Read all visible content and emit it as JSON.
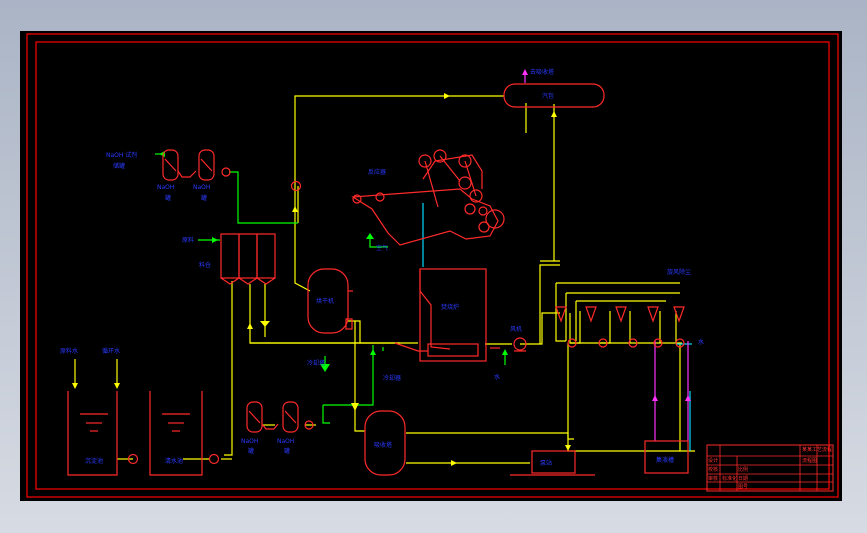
{
  "colors": {
    "background": "#000000",
    "frame": "#ff0000",
    "equipment": "#ff2a2a",
    "pipe_main": "#ffff00",
    "pipe_green": "#00ff00",
    "pipe_cyan": "#00d8ff",
    "pipe_magenta": "#ff33ff",
    "label": "#2a3aff"
  },
  "labels": {
    "top_right_out": "去吸收塔",
    "steam_tank": "汽包",
    "top_left_a": "NaOH 试剂",
    "top_left_b": "储罐",
    "tank1": "NaOH",
    "tank1_b": "罐",
    "tank2": "NaOH",
    "tank2_b": "罐",
    "reactor_top": "反应器",
    "air_in": "空气",
    "mid_left": "原料",
    "silo": "料仓",
    "dryer": "烘干机",
    "furnace": "焚烧炉",
    "fan": "风机",
    "mid_bottom": "冷却塔",
    "bottom_mid": "冷却器",
    "right_cluster": "旋风除尘",
    "right_small": "水",
    "left_in1": "原料水",
    "left_in2": "循环水",
    "pool1": "沉淀池",
    "pool2": "清水池",
    "lower_tank1": "NaOH",
    "lower_tank1_b": "罐",
    "lower_tank2": "NaOH",
    "lower_tank2_b": "罐",
    "water_label": "水",
    "absorber": "吸收塔",
    "pump_station": "泵站",
    "collector": "集液槽"
  },
  "title_block": {
    "r1": "某某工艺流程",
    "r2": "设计",
    "r3": "校核",
    "r4": "审核",
    "r5": "标准化",
    "r6": "比例",
    "r7": "日期",
    "r8": "图号",
    "r9": "流程图"
  }
}
